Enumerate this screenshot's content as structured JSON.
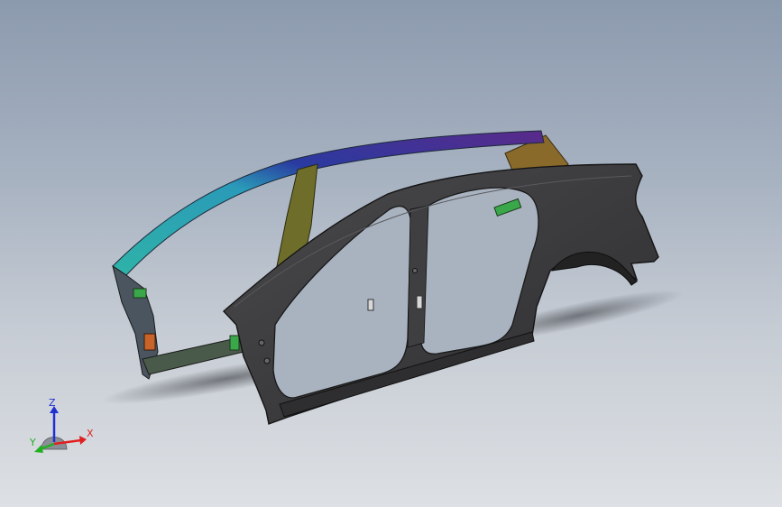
{
  "viewport": {
    "background_top": "#8c9aae",
    "background_bottom": "#dde0e4",
    "model_colors": {
      "outer_panel": "#3a3a3c",
      "outer_panel_edge": "#1a1a1a",
      "roof_rail_front": "#2fb3a8",
      "roof_rail_mid": "#2a3aa0",
      "roof_rail_rear": "#5a2a8a",
      "b_pillar": "#6e6e2a",
      "rear_bracket": "#8a6a2a",
      "sill_inner": "#4a5a4a",
      "reinforcement_green": "#3aa84a",
      "reinforcement_orange": "#c8642a"
    }
  },
  "triad": {
    "x_label": "X",
    "y_label": "Y",
    "z_label": "Z",
    "x_color": "#e02020",
    "y_color": "#20b020",
    "z_color": "#2030d0"
  }
}
